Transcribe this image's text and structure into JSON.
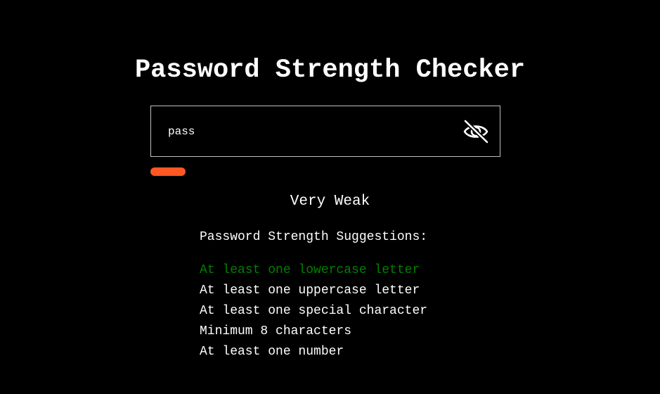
{
  "header": {
    "title": "Password Strength Checker"
  },
  "password_field": {
    "value": "pass",
    "toggle_icon": "eye-off-icon"
  },
  "strength": {
    "label": "Very Weak",
    "level": 0.1,
    "color": "#ff5722"
  },
  "suggestions": {
    "heading": "Password Strength Suggestions:",
    "met_color": "#008000",
    "unmet_color": "#ffffff",
    "items": [
      {
        "text": "At least one lowercase letter",
        "met": true
      },
      {
        "text": "At least one uppercase letter",
        "met": false
      },
      {
        "text": "At least one special character",
        "met": false
      },
      {
        "text": "Minimum 8 characters",
        "met": false
      },
      {
        "text": "At least one number",
        "met": false
      }
    ]
  }
}
